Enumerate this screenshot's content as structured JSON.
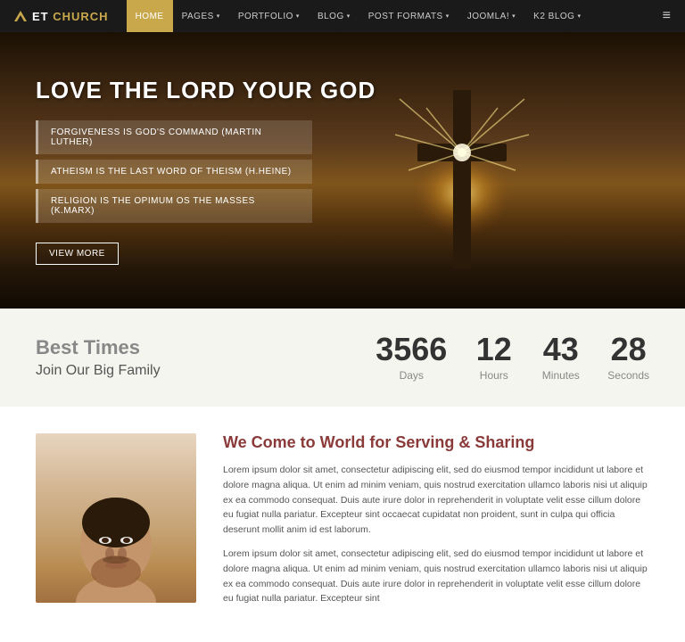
{
  "nav": {
    "logo_text": "ET CHURCH",
    "logo_main": "ET ",
    "logo_accent": "CHURCH",
    "items": [
      {
        "label": "HOME",
        "active": true,
        "has_arrow": false
      },
      {
        "label": "PAGES",
        "active": false,
        "has_arrow": true
      },
      {
        "label": "PORTFOLIO",
        "active": false,
        "has_arrow": true
      },
      {
        "label": "BLOG",
        "active": false,
        "has_arrow": true
      },
      {
        "label": "POST FORMATS",
        "active": false,
        "has_arrow": true
      },
      {
        "label": "JOOMLA!",
        "active": false,
        "has_arrow": true
      },
      {
        "label": "K2 BLOG",
        "active": false,
        "has_arrow": true
      }
    ],
    "hamburger": "≡"
  },
  "hero": {
    "title": "LOVE THE LORD YOUR GOD",
    "quotes": [
      "FORGIVENESS IS GOD'S COMMAND (Martin Luther)",
      "ATHEISM IS THE LAST WORD OF THEISM (H.Heine)",
      "RELIGION IS THE OPIMUM OS THE MASSES (K.Marx)"
    ],
    "button_label": "View More"
  },
  "countdown": {
    "heading": "Best Times",
    "subheading": "Join Our Big Family",
    "units": [
      {
        "value": "3566",
        "label": "Days"
      },
      {
        "value": "12",
        "label": "Hours"
      },
      {
        "value": "43",
        "label": "Minutes"
      },
      {
        "value": "28",
        "label": "Seconds"
      }
    ]
  },
  "about": {
    "title": "We Come to World for Serving & Sharing",
    "paragraphs": [
      "Lorem ipsum dolor sit amet, consectetur adipiscing elit, sed do eiusmod tempor incididunt ut labore et dolore magna aliqua. Ut enim ad minim veniam, quis nostrud exercitation ullamco laboris nisi ut aliquip ex ea commodo consequat. Duis aute irure dolor in reprehenderit in voluptate velit esse cillum dolore eu fugiat nulla pariatur. Excepteur sint occaecat cupidatat non proident, sunt in culpa qui officia deserunt mollit anim id est laborum.",
      "Lorem ipsum dolor sit amet, consectetur adipiscing elit, sed do eiusmod tempor incididunt ut labore et dolore magna aliqua. Ut enim ad minim veniam, quis nostrud exercitation ullamco laboris nisi ut aliquip ex ea commodo consequat. Duis aute irure dolor in reprehenderit in voluptate velit esse cillum dolore eu fugiat nulla pariatur. Excepteur sint"
    ]
  }
}
